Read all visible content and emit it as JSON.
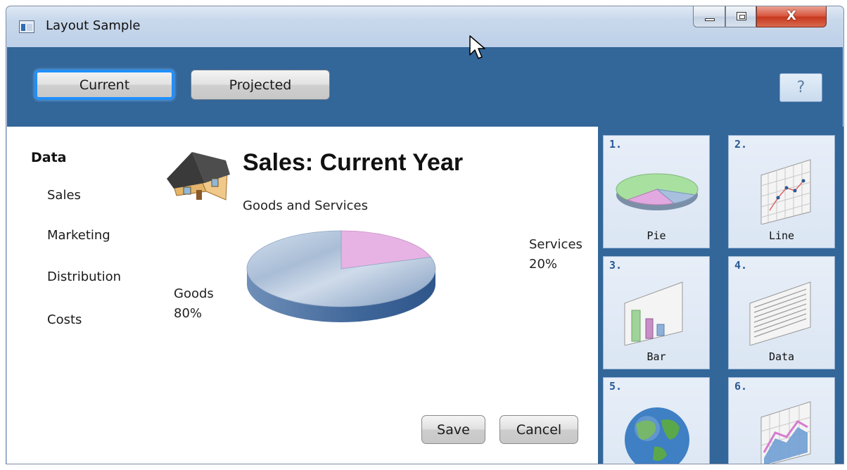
{
  "window": {
    "title": "Layout Sample",
    "controls": {
      "minimize": "minimize",
      "maximize": "maximize",
      "close": "X"
    }
  },
  "toolbar": {
    "current_label": "Current",
    "projected_label": "Projected",
    "help_label": "?"
  },
  "sidebar": {
    "heading": "Data",
    "items": [
      {
        "label": "Sales"
      },
      {
        "label": "Marketing"
      },
      {
        "label": "Distribution"
      },
      {
        "label": "Costs"
      }
    ]
  },
  "main": {
    "title": "Sales:  Current Year",
    "subtitle": "Goods and Services",
    "pie_labels": {
      "services_name": "Services",
      "services_pct": "20%",
      "goods_name": "Goods",
      "goods_pct": "80%"
    },
    "save_label": "Save",
    "cancel_label": "Cancel"
  },
  "chart_data": {
    "type": "pie",
    "title": "",
    "categories": [
      "Goods",
      "Services"
    ],
    "values": [
      80,
      20
    ],
    "colors": [
      "#8fa9c8",
      "#e7b3e4"
    ]
  },
  "gallery": {
    "tiles": [
      {
        "number": "1.",
        "label": "Pie",
        "icon": "pie-chart-icon"
      },
      {
        "number": "2.",
        "label": "Line",
        "icon": "line-chart-icon"
      },
      {
        "number": "3.",
        "label": "Bar",
        "icon": "bar-chart-icon"
      },
      {
        "number": "4.",
        "label": "Data",
        "icon": "data-sheet-icon"
      },
      {
        "number": "5.",
        "label": "",
        "icon": "globe-icon"
      },
      {
        "number": "6.",
        "label": "",
        "icon": "area-chart-icon"
      }
    ]
  },
  "colors": {
    "toolbar_blue": "#336699",
    "focus_ring": "#1e90ff",
    "tile_number": "#2b5a95"
  }
}
